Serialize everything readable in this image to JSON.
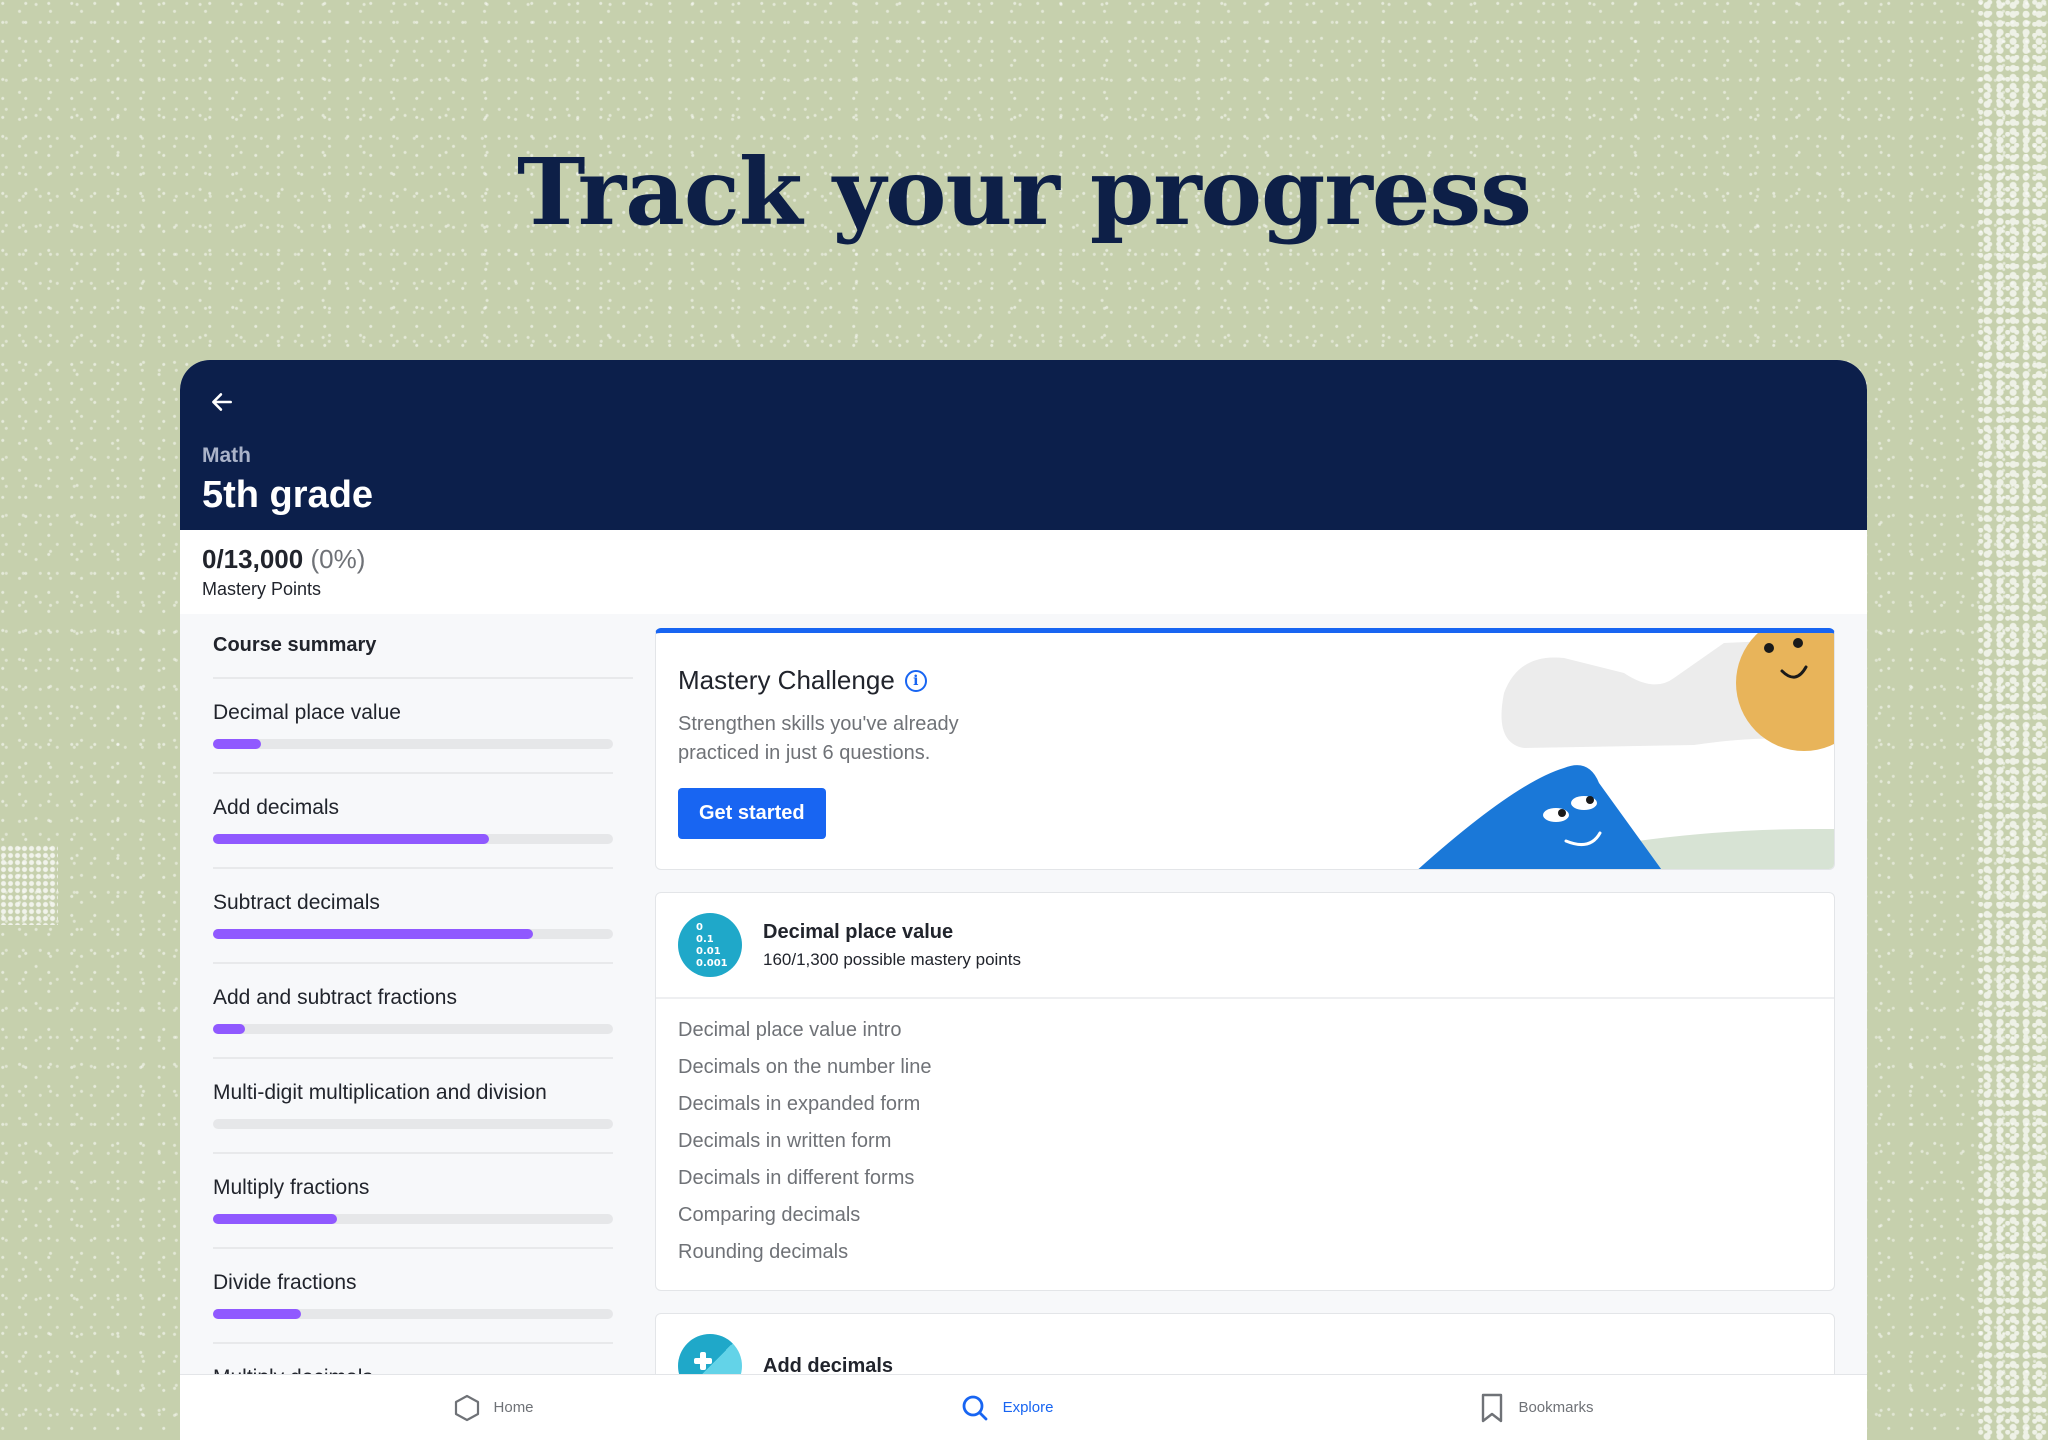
{
  "hero": {
    "title": "Track your progress"
  },
  "header": {
    "back_icon": "arrow-left-icon",
    "subject": "Math",
    "course": "5th grade"
  },
  "mastery": {
    "score": "0/13,000",
    "percent": "(0%)",
    "label": "Mastery Points"
  },
  "sidebar": {
    "heading": "Course summary",
    "units": [
      {
        "name": "Decimal place value",
        "progress": 0.12
      },
      {
        "name": "Add decimals",
        "progress": 0.69
      },
      {
        "name": "Subtract decimals",
        "progress": 0.8
      },
      {
        "name": "Add and subtract fractions",
        "progress": 0.08
      },
      {
        "name": "Multi-digit multiplication and division",
        "progress": 0.0
      },
      {
        "name": "Multiply fractions",
        "progress": 0.31
      },
      {
        "name": "Divide fractions",
        "progress": 0.22
      },
      {
        "name": "Multiply decimals",
        "progress": 0.0
      }
    ]
  },
  "challenge": {
    "title": "Mastery Challenge",
    "info_icon": "info-icon",
    "description": "Strengthen skills you've already practiced in just 6 questions.",
    "button": "Get started"
  },
  "unit_cards": [
    {
      "title": "Decimal place value",
      "subtitle": "160/1,300 possible mastery points",
      "icon_lines": [
        "0",
        "0.1",
        "0.01",
        "0.001"
      ],
      "lessons": [
        "Decimal place value intro",
        "Decimals on the number line",
        "Decimals in expanded form",
        "Decimals in written form",
        "Decimals in different forms",
        "Comparing decimals",
        "Rounding decimals"
      ]
    },
    {
      "title": "Add decimals",
      "icon": "plus-icon"
    }
  ],
  "bottom_nav": [
    {
      "label": "Home",
      "icon": "hexagon-icon",
      "active": false
    },
    {
      "label": "Explore",
      "icon": "search-icon",
      "active": true
    },
    {
      "label": "Bookmarks",
      "icon": "bookmark-icon",
      "active": false
    }
  ],
  "colors": {
    "background": "#c6d0ad",
    "header": "#0c1f4b",
    "accent": "#1865f2",
    "progress": "#9059ff",
    "unit_icon": "#1fa8c9"
  }
}
